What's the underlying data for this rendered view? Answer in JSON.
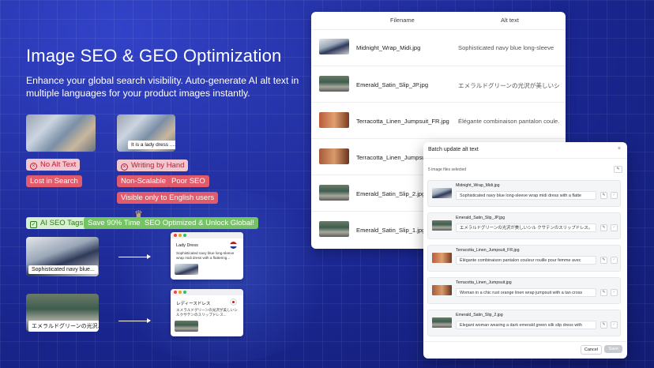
{
  "hero": {
    "title": "Image SEO & GEO Optimization",
    "subtitle": "Enhance your global search visibility. Auto-generate AI alt text in multiple languages for your product images instantly."
  },
  "problems": {
    "left_caption": "",
    "right_caption": "It is a lady dress ....",
    "chip_no_alt": "No Alt Text",
    "chip_lost": "Lost in Search",
    "chip_writing": "Writing by Hand",
    "chip_nonscalable": "Non-Scalable",
    "chip_poor": "Poor SEO",
    "chip_english": "Visible only to English users"
  },
  "benefits": {
    "chip_tags": "AI SEO Tags",
    "chip_save": "Save 90% Time",
    "chip_optimized": "SEO Optimized & Unlock Global!",
    "example1_caption": "Sophisticated navy blue...",
    "example2_caption": "エメラルドグリーンの光沢...",
    "card1_title": "Lady Dress",
    "card1_body": "Sophisticated navy blue long-sleeve wrap midi dress with a flattering...",
    "card2_title": "レディースドレス",
    "card2_body": "エメラルドグリーンの光沢が美しいシルクサテンのスリップドレス..."
  },
  "table": {
    "col_filename": "Filename",
    "col_alt": "Alt text",
    "rows": [
      {
        "filename": "Midnight_Wrap_Midi.jpg",
        "alt": "Sophisticated navy blue long-sleeve"
      },
      {
        "filename": "Emerald_Satin_Slip_JP.jpg",
        "alt": "エメラルドグリーンの光沢が美しいシ"
      },
      {
        "filename": "Terracotta_Linen_Jumpsuit_FR.jpg",
        "alt": "Élégante combinaison pantalon coule..."
      },
      {
        "filename": "Terracotta_Linen_Jumpsui",
        "alt": ""
      },
      {
        "filename": "Emerald_Satin_Slip_2.jpg",
        "alt": ""
      },
      {
        "filename": "Emerald_Satin_Slip_1.jpg",
        "alt": ""
      }
    ]
  },
  "modal": {
    "title": "Batch update alt text",
    "close": "×",
    "count": "5 image files selected",
    "items": [
      {
        "filename": "Midnight_Wrap_Midi.jpg",
        "alt": "Sophisticated navy blue long-sleeve  wrap midi dress with a flatte"
      },
      {
        "filename": "Emerald_Satin_Slip_JP.jpg",
        "alt": "エメラルドグリーンの光沢が美しいシル クサテンのスリップドレス。"
      },
      {
        "filename": "Terracotta_Linen_Jumpsuit_FR.jpg",
        "alt": "Élégante combinaison pantalon couleur rouille pour femme avec"
      },
      {
        "filename": "Terracotta_Linen_Jumpsuit.jpg",
        "alt": "Woman in a chic rust orange linen wrap jumpsuit with a tan cross"
      },
      {
        "filename": "Emerald_Satin_Slip_2.jpg",
        "alt": "Elegant woman wearing a dark emerald green silk slip dress with"
      }
    ],
    "cancel": "Cancel",
    "save": "Save"
  }
}
